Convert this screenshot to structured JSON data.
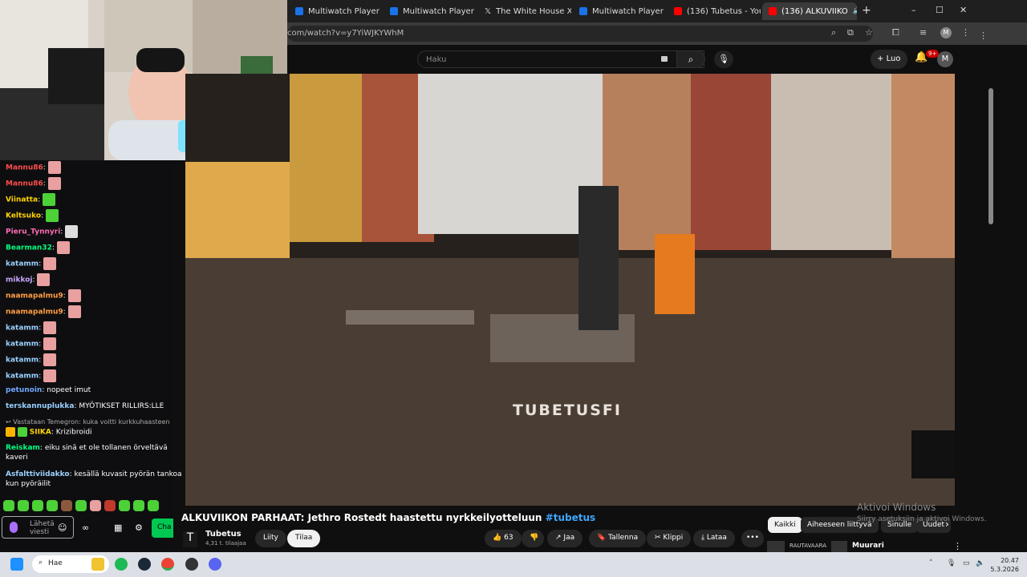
{
  "browser": {
    "tabs": [
      {
        "title": "Multiwatch Player w",
        "color": "#1a73e8"
      },
      {
        "title": "Multiwatch Player w",
        "color": "#1a73e8"
      },
      {
        "title": "The White House X",
        "color": "#000000"
      },
      {
        "title": "Multiwatch Player w",
        "color": "#1a73e8"
      },
      {
        "title": "(136) Tubetus - You",
        "color": "#ff0000"
      },
      {
        "title": "(136) ALKUVIIKO",
        "color": "#ff0000"
      }
    ],
    "new_tab": "+",
    "url": "com/watch?v=y7YiWJKYWhM",
    "window_buttons": [
      "–",
      "☐",
      "✕"
    ],
    "profile": "M"
  },
  "youtube": {
    "search_placeholder": "Haku",
    "create_label": "Luo",
    "notif_count": "9+",
    "avatar": "M",
    "video_title": "ALKUVIIKON PARHAAT: Jethro Rostedt haastettu nyrkkeilyotteluun",
    "video_hashtag": "#tubetus",
    "watermark": "TUBETUSFI",
    "channel": "Tubetus",
    "subscribers": "4,31 t. tilaajaa",
    "join": "Liity",
    "subscribe": "Tilaa",
    "likes": "63",
    "share": "Jaa",
    "save": "Tallenna",
    "clip": "Klippi",
    "download": "Lataa",
    "more": "•••",
    "chips": [
      "Kaikki",
      "Aiheeseen liittyvä",
      "Sinulle",
      "Uudet"
    ],
    "side_item_1": "RAUTAVAARA",
    "side_item_2": "Muurari"
  },
  "windows_activate": {
    "title": "Aktivoi Windows",
    "subtitle": "Siirry asetuksiin ja aktivoi Windows."
  },
  "chat": {
    "messages": [
      {
        "user": "Mannu86",
        "color": "#ff4d4d",
        "text": "",
        "emote": "#e8a0a0"
      },
      {
        "user": "Mannu86",
        "color": "#ff4d4d",
        "text": "",
        "emote": "#e8a0a0"
      },
      {
        "user": "Viinatta",
        "color": "#ffd400",
        "text": "",
        "emote": "#4cd137"
      },
      {
        "user": "Keltsuko",
        "color": "#ffd400",
        "text": "",
        "emote": "#4cd137"
      },
      {
        "user": "Pieru_Tynnyri",
        "color": "#ff6bb5",
        "text": "",
        "emote": "#dddddd"
      },
      {
        "user": "Bearman32",
        "color": "#00ff7f",
        "text": "",
        "emote": "#e8a0a0"
      },
      {
        "user": "katamm",
        "color": "#9ad0ff",
        "text": "",
        "emote": "#e8a0a0"
      },
      {
        "user": "mikkoj",
        "color": "#c7a6ff",
        "text": "",
        "emote": "#e8a0a0"
      },
      {
        "user": "naamapalmu9",
        "color": "#ff9f43",
        "text": "",
        "emote": "#e8a0a0"
      },
      {
        "user": "naamapalmu9",
        "color": "#ff9f43",
        "text": "",
        "emote": "#e8a0a0"
      },
      {
        "user": "katamm",
        "color": "#9ad0ff",
        "text": "",
        "emote": "#e8a0a0"
      },
      {
        "user": "katamm",
        "color": "#9ad0ff",
        "text": "",
        "emote": "#e8a0a0"
      },
      {
        "user": "katamm",
        "color": "#9ad0ff",
        "text": "",
        "emote": "#e8a0a0"
      },
      {
        "user": "katamm",
        "color": "#9ad0ff",
        "text": "",
        "emote": "#e8a0a0"
      },
      {
        "user": "petunoin",
        "color": "#6fa8ff",
        "text": "nopeet imut",
        "emote": ""
      },
      {
        "user": "terskannuplukka",
        "color": "#9ad0ff",
        "text": "MYÖTIKSET RILLIRS:LLE",
        "emote": ""
      }
    ],
    "reply_note": "Vastataan Temegron: kuka voitti kurkkuhaasteen",
    "m17_user": "SIIKA",
    "m17_text": "Krizibroidi",
    "m18_user": "Reiskam",
    "m18_text": "eiku sinä et ole tollanen örveltävä",
    "m18_text2": "kaveri",
    "m19_user": "Asfalttiviidakko",
    "m19_text": "kesällä kuvasit pyörän tankoa",
    "m19_text2": "kun pyöräilit",
    "input_placeholder": "Lähetä viesti",
    "send_label": "Cha"
  },
  "taskbar": {
    "search": "Hae",
    "time": "20.47",
    "date": "5.3.2026"
  }
}
